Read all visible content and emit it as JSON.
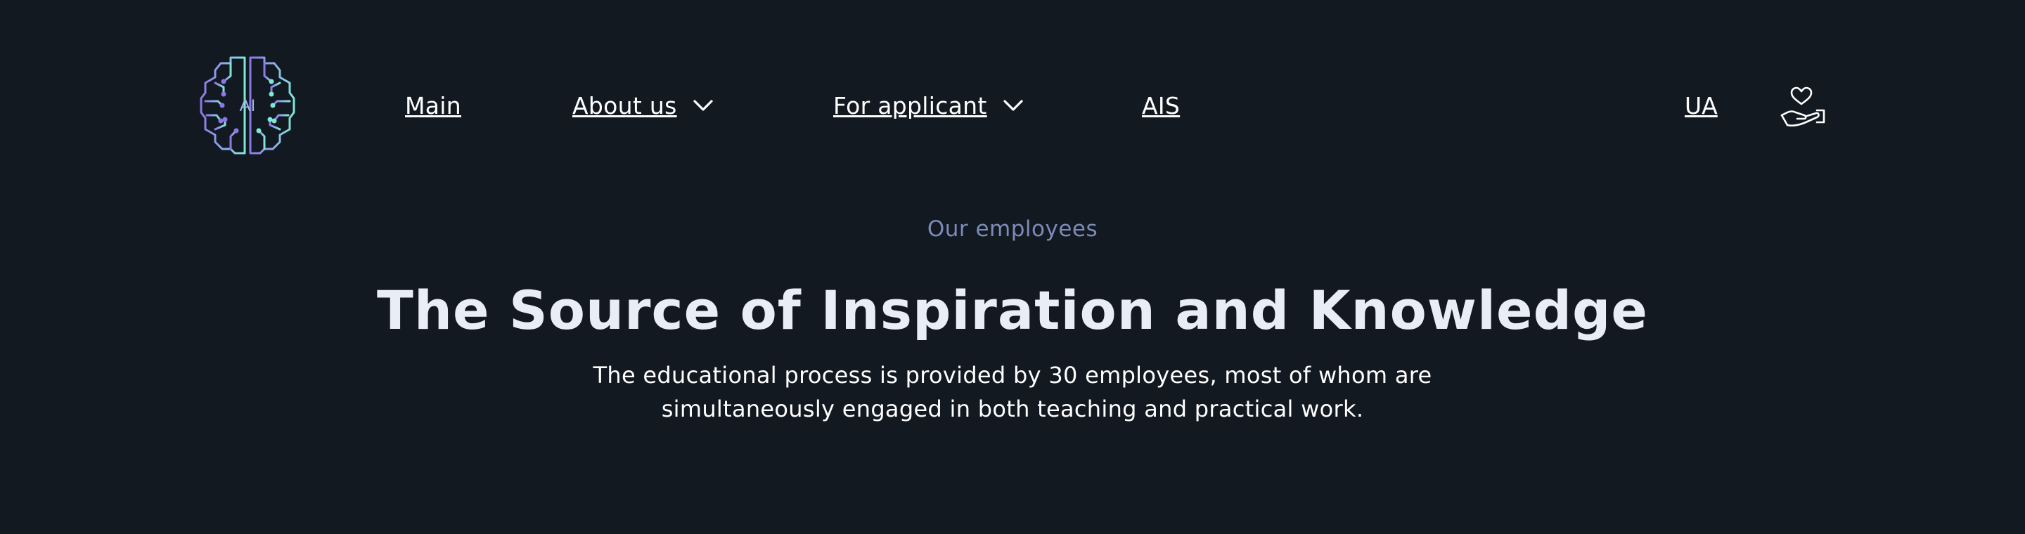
{
  "header": {
    "logo_text": "AI",
    "nav": {
      "main": "Main",
      "about": "About us",
      "applicant": "For applicant",
      "ais": "AIS"
    },
    "language": "UA",
    "icons": {
      "logo": "brain-circuit-logo",
      "dropdown": "chevron-down-icon",
      "donate": "hand-heart-icon"
    }
  },
  "hero": {
    "eyebrow": "Our employees",
    "title": "The Source of Inspiration and Knowledge",
    "description": "The educational process is provided by 30 employees, most of whom are simultaneously engaged in both teaching and practical work."
  },
  "colors": {
    "background": "#131921",
    "eyebrow": "#7c8bb8",
    "title": "#e9edf5",
    "logo_left": "#8a78e6",
    "logo_right": "#7ee8d6"
  }
}
